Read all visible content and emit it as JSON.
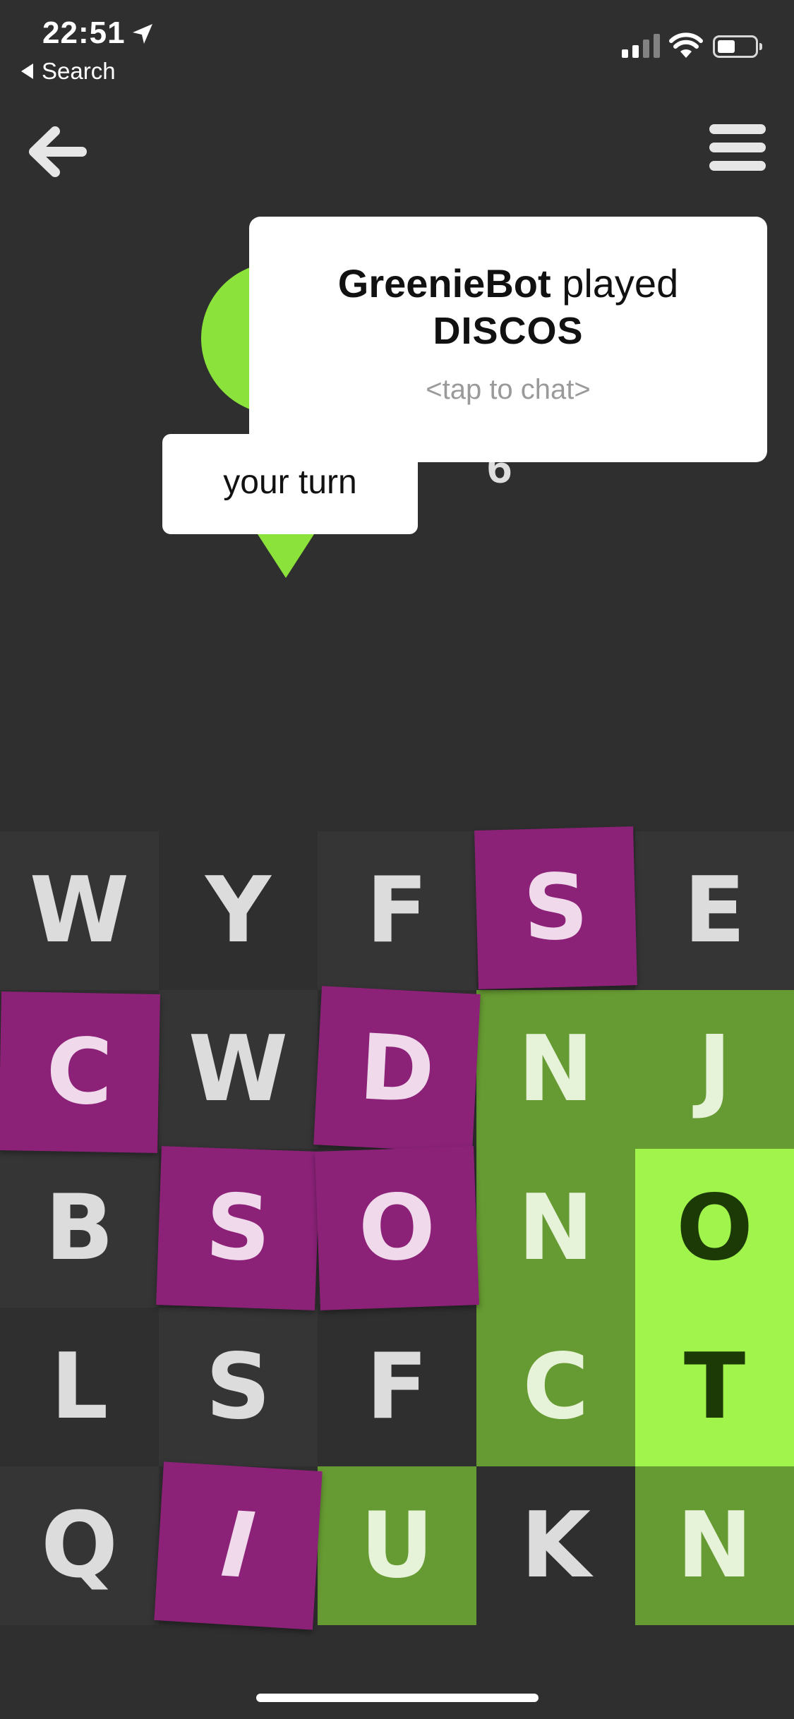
{
  "status_bar": {
    "time": "22:51",
    "back_label": "Search"
  },
  "header": {
    "popup": {
      "player": "GreenieBot",
      "verb": "played",
      "word": "DISCOS",
      "hint": "<tap to chat>"
    },
    "turn_label": "your turn",
    "opponent_score": "6"
  },
  "colors": {
    "background": "#2f2f2f",
    "neutral_a": "#353535",
    "neutral_b": "#2f2f2f",
    "selected": "#8b2278",
    "light_green": "#a0f44c",
    "dark_green": "#669a32"
  },
  "board": {
    "columns": 5,
    "rows": 5,
    "tiles": [
      {
        "letter": "W",
        "state": "neutral"
      },
      {
        "letter": "Y",
        "state": "neutral"
      },
      {
        "letter": "F",
        "state": "neutral"
      },
      {
        "letter": "S",
        "state": "selected"
      },
      {
        "letter": "E",
        "state": "neutral"
      },
      {
        "letter": "C",
        "state": "selected"
      },
      {
        "letter": "W",
        "state": "neutral"
      },
      {
        "letter": "D",
        "state": "selected"
      },
      {
        "letter": "N",
        "state": "dark_green"
      },
      {
        "letter": "J",
        "state": "dark_green"
      },
      {
        "letter": "B",
        "state": "neutral"
      },
      {
        "letter": "S",
        "state": "selected"
      },
      {
        "letter": "O",
        "state": "selected"
      },
      {
        "letter": "N",
        "state": "dark_green"
      },
      {
        "letter": "O",
        "state": "light_green"
      },
      {
        "letter": "L",
        "state": "neutral"
      },
      {
        "letter": "S",
        "state": "neutral"
      },
      {
        "letter": "F",
        "state": "neutral"
      },
      {
        "letter": "C",
        "state": "dark_green"
      },
      {
        "letter": "T",
        "state": "light_green"
      },
      {
        "letter": "Q",
        "state": "neutral"
      },
      {
        "letter": "I",
        "state": "selected"
      },
      {
        "letter": "U",
        "state": "dark_green"
      },
      {
        "letter": "K",
        "state": "neutral"
      },
      {
        "letter": "N",
        "state": "dark_green"
      }
    ]
  }
}
